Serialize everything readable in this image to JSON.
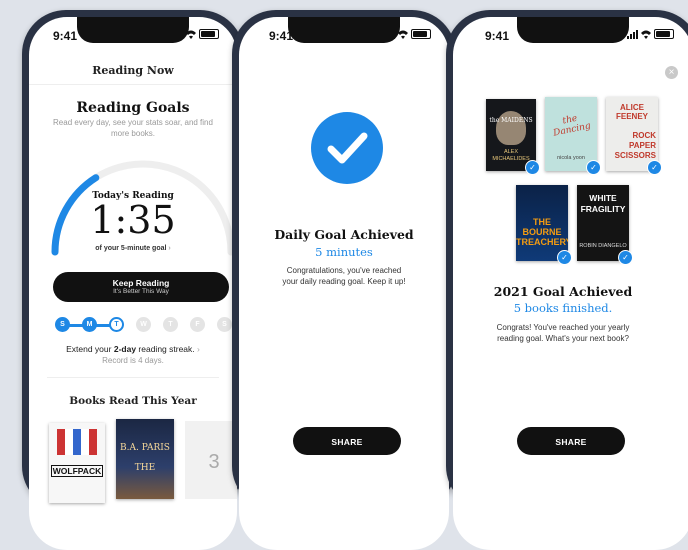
{
  "status_bar": {
    "time": "9:41"
  },
  "phone1": {
    "header": "Reading Now",
    "goals_title": "Reading Goals",
    "goals_desc_1": "Read every day, see your stats soar, and find",
    "goals_desc_2": "more books.",
    "todays_label": "Today's Reading",
    "todays_time": "1:35",
    "goal_caption": "of your 5-minute goal",
    "progress_fraction": 0.32,
    "keep_reading": "Keep Reading",
    "keep_reading_sub": "It's Better This Way",
    "days": [
      {
        "letter": "S",
        "state": "done"
      },
      {
        "letter": "M",
        "state": "done"
      },
      {
        "letter": "T",
        "state": "today"
      },
      {
        "letter": "W",
        "state": "future"
      },
      {
        "letter": "T",
        "state": "future"
      },
      {
        "letter": "F",
        "state": "future"
      },
      {
        "letter": "S",
        "state": "future"
      }
    ],
    "streak_pre": "Extend your ",
    "streak_bold": "2-day",
    "streak_post": " reading streak.",
    "record": "Record is 4 days.",
    "books_title": "Books Read This Year",
    "books": {
      "wolfpack": "WOLFPACK",
      "author": "B.A. PARIS",
      "book_title": "THE",
      "count": "3"
    }
  },
  "phone2": {
    "title": "Daily Goal Achieved",
    "subtitle": "5 minutes",
    "msg_1": "Congratulations, you've reached",
    "msg_2": "your daily reading goal. Keep it up!",
    "share": "SHARE"
  },
  "phone3": {
    "title": "2021 Goal Achieved",
    "subtitle": "5 books finished.",
    "msg_1": "Congrats! You've reached your yearly",
    "msg_2": "reading goal. What's your next book?",
    "share": "SHARE",
    "covers": {
      "c1_title": "the MAIDENS",
      "c1_author": "ALEX MICHAELIDES",
      "c2_title": "the Dancing",
      "c2_author": "nicola yoon",
      "c3_author": "ALICE FEENEY",
      "c3_title": "ROCK PAPER SCISSORS",
      "c4_title": "THE BOURNE TREACHERY",
      "c5_title": "WHITE FRAGILITY",
      "c5_author": "ROBIN DIANGELO"
    }
  },
  "colors": {
    "accent": "#1e88e5",
    "dark": "#111111"
  }
}
